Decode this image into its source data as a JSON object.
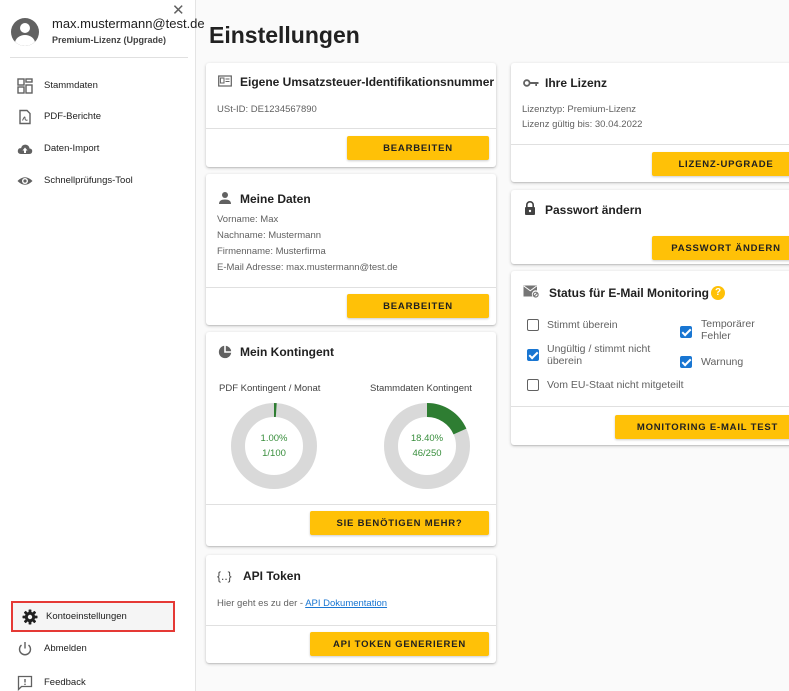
{
  "user": {
    "email": "max.mustermann@test.de",
    "license_hint": "Premium-Lizenz (Upgrade)",
    "close_glyph": "✕"
  },
  "sidebar": {
    "items": [
      {
        "label": "Stammdaten",
        "icon": "grid-icon"
      },
      {
        "label": "PDF-Berichte",
        "icon": "pdf-icon"
      },
      {
        "label": "Daten-Import",
        "icon": "cloud-upload-icon"
      },
      {
        "label": "Schnellprüfungs-Tool",
        "icon": "eye-icon"
      }
    ],
    "bottom_items": [
      {
        "label": "Kontoeinstellungen",
        "icon": "gear-icon",
        "active": true
      },
      {
        "label": "Abmelden",
        "icon": "power-icon"
      },
      {
        "label": "Feedback",
        "icon": "feedback-icon"
      }
    ]
  },
  "page": {
    "title": "Einstellungen"
  },
  "vat_card": {
    "title": "Eigene Umsatzsteuer-Identifikationsnummer",
    "text": "USt-ID: DE1234567890",
    "button": "BEARBEITEN"
  },
  "my_data_card": {
    "title": "Meine Daten",
    "lines": [
      "Vorname: Max",
      "Nachname: Mustermann",
      "Firmenname: Musterfirma",
      "E-Mail Adresse: max.mustermann@test.de"
    ],
    "button": "BEARBEITEN"
  },
  "quota_card": {
    "title": "Mein Kontingent",
    "gauges": [
      {
        "label": "PDF Kontingent / Monat",
        "percent": "1.00%",
        "count": "1/100",
        "fraction": 0.01
      },
      {
        "label": "Stammdaten Kontingent",
        "percent": "18.40%",
        "count": "46/250",
        "fraction": 0.184
      }
    ],
    "button": "SIE BENÖTIGEN MEHR?"
  },
  "api_card": {
    "title": "API Token",
    "icon_text": "{..}",
    "text_prefix": "Hier geht es zu der - ",
    "link": "API Dokumentation",
    "button": "API TOKEN GENERIEREN"
  },
  "license_card": {
    "title": "Ihre Lizenz",
    "lines": [
      "Lizenztyp: Premium-Lizenz",
      "Lizenz gültig bis: 30.04.2022"
    ],
    "button": "LIZENZ-UPGRADE"
  },
  "password_card": {
    "title": "Passwort ändern",
    "button": "PASSWORT ÄNDERN"
  },
  "monitoring_card": {
    "title": "Status für E-Mail Monitoring",
    "help": "?",
    "options": [
      {
        "label": "Stimmt überein",
        "checked": false
      },
      {
        "label": "Temporärer Fehler",
        "checked": true
      },
      {
        "label": "Ungültig / stimmt nicht überein",
        "checked": true
      },
      {
        "label": "Warnung",
        "checked": true
      },
      {
        "label": "Vom EU-Staat nicht mitgeteilt",
        "checked": false
      }
    ],
    "button": "MONITORING E-MAIL TEST"
  },
  "colors": {
    "accent": "#ffc107",
    "gauge_fill": "#2e7d32",
    "gauge_track": "#d9d9d9",
    "active_outline": "#e53935"
  }
}
